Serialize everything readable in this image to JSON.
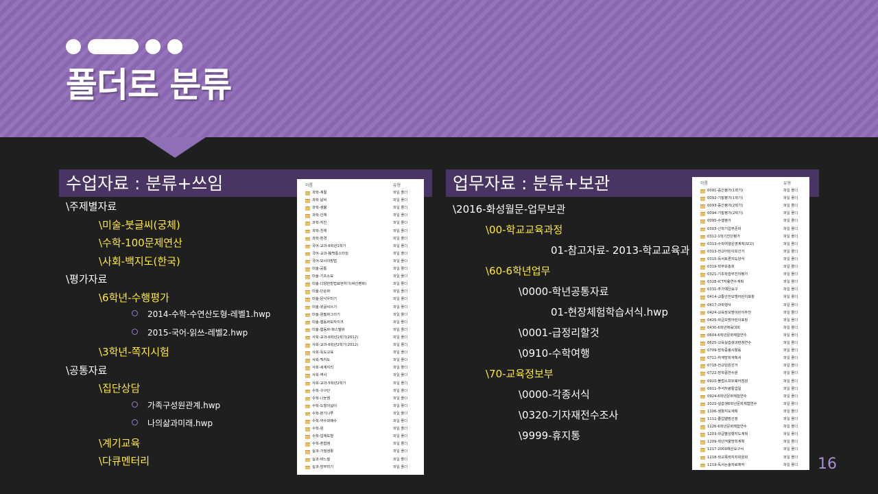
{
  "slide": {
    "title": "폴더로 분류",
    "page_number": "16"
  },
  "left": {
    "heading": "수업자료 : 분류+쓰임",
    "tree": [
      {
        "text": "\\주제별자료",
        "level": 0,
        "color": "white"
      },
      {
        "text": "\\미술-붓글씨(궁체)",
        "level": 1,
        "color": "yellow"
      },
      {
        "text": "\\수학-100문제연산",
        "level": 1,
        "color": "yellow"
      },
      {
        "text": "\\사회-백지도(한국)",
        "level": 1,
        "color": "yellow"
      },
      {
        "text": "\\평가자료",
        "level": 0,
        "color": "white"
      },
      {
        "text": "\\6학년-수행평가",
        "level": 1,
        "color": "yellow"
      },
      {
        "text": "2014-수학-수연산도형-레벨1.hwp",
        "level": 2,
        "color": "white"
      },
      {
        "text": "2015-국어-읽쓰-레벨2.hwp",
        "level": 2,
        "color": "white"
      },
      {
        "text": "\\3학년-쪽지시험",
        "level": 1,
        "color": "yellow"
      },
      {
        "text": "\\공통자료",
        "level": 0,
        "color": "white"
      },
      {
        "text": "\\집단상담",
        "level": 1,
        "color": "yellow"
      },
      {
        "text": "가족구성원관계.hwp",
        "level": 2,
        "color": "white"
      },
      {
        "text": "나의삶과미래.hwp",
        "level": 2,
        "color": "white"
      },
      {
        "text": "\\계기교육",
        "level": 1,
        "color": "yellow"
      },
      {
        "text": "\\다큐멘터리",
        "level": 1,
        "color": "yellow"
      }
    ],
    "explorer": {
      "col_name": "이름",
      "col_type": "유형",
      "type_label": "파일 폴더",
      "items": [
        "과학-계절",
        "과학-날씨",
        "과학-생물",
        "과학-인체",
        "과학-지진",
        "과학-천체",
        "과학-환경",
        "국어-교과-6학년1학기",
        "국어-교과-独백통스타킹",
        "국어-모사의방법",
        "미술-공통",
        "미술-기초소묘",
        "미술-다양한방법표현하기(싸인펜화)",
        "미술-단순화",
        "미술-문낙우미기",
        "미술-붓글씨쓰기",
        "미술-원필화그리기",
        "미술-협동화모자이크",
        "미술-협동화-파스텔화",
        "사회-교과-6학년1학기(2012)",
        "사회-교과-6학년2학기(2012)",
        "사회-독도교육",
        "사회-백지도",
        "사회-세계지리",
        "사회-역사",
        "사회-교과-5학년2학기",
        "수학-구구단",
        "수학-나눗셈",
        "수학-도형의넓이",
        "수학-분기나루",
        "수학-약수와배수",
        "수학-원",
        "수학-입체도형",
        "수학-혼합셈",
        "실과-가정생활",
        "실과-바느질",
        "실과-방무미기"
      ]
    }
  },
  "right": {
    "heading": "업무자료 : 분류+보관",
    "tree": [
      {
        "text": "\\2016-화성월문-업무보관",
        "level": 0,
        "color": "white"
      },
      {
        "text": "\\00-학교교육과정",
        "level": 1,
        "color": "yellow"
      },
      {
        "text": "01-참고자료- 2013-학교교육과",
        "level": 3,
        "color": "white"
      },
      {
        "text": "\\60-6학년업무",
        "level": 1,
        "color": "yellow"
      },
      {
        "text": "\\0000-학년공통자료",
        "level": 2,
        "color": "white"
      },
      {
        "text": "01-현장체험학습서식.hwp",
        "level": 3,
        "color": "white"
      },
      {
        "text": "\\0001-급정리할것",
        "level": 2,
        "color": "white"
      },
      {
        "text": "\\0910-수학여행",
        "level": 2,
        "color": "white"
      },
      {
        "text": "\\70-교육정보부",
        "level": 1,
        "color": "yellow"
      },
      {
        "text": "\\0000-각종서식",
        "level": 2,
        "color": "white"
      },
      {
        "text": "\\0320-기자재전수조사",
        "level": 2,
        "color": "white"
      },
      {
        "text": "\\9999-휴지통",
        "level": 2,
        "color": "white"
      }
    ],
    "explorer": {
      "col_name": "이름",
      "col_type": "유형",
      "type_label": "파일 폴더",
      "items": [
        "0091-중간평가(1학기)",
        "0092-기말평가(1학기)",
        "0093-중간평가(2학기)",
        "0094-기말평가(2학기)",
        "0095-수행평가",
        "0303-신학기업무준비",
        "0312-1학기진단평가",
        "0313-수학여행운영계획(보고)",
        "0313-전교어린이회선거",
        "0315-독서토론지도양식",
        "0319-학부모총회",
        "0321-기초학습부진아평가",
        "0328-ICT자율연수계획",
        "0331-추가예산요구",
        "0414-교통안전모범어린이표창",
        "0417-과학행사",
        "0424-교육장모범어린이추천",
        "0425-학급모범어린이표창",
        "0430-6학년체육대회",
        "0604-6학년문화체험연수",
        "0625-교육실습생과련정연수",
        "0709-방학중봉사활동",
        "0711-하계방학계획서",
        "0718-전교임원선거",
        "0722-방학중연수원",
        "0910-불법소프트웨어점검",
        "0911-추석차량통업일",
        "0924-6학년문화체험연수",
        "1022-실습생6학년문화체험연수",
        "1106-생활지도계획",
        "1111-졸업앨범선정",
        "1126-6학년문화체험연수",
        "1203-학급별성향지도계획",
        "1209-학년겨울방학계획",
        "1217-2009예산요구서",
        "1218-학교폭력자치위원회",
        "1219-독서논술자료제작"
      ]
    }
  },
  "colors": {
    "band": "#8a66b0",
    "section_bar": "#4a3463",
    "highlight": "#ffea3a",
    "background": "#1f1f1f",
    "page_number": "#a98fd0"
  }
}
